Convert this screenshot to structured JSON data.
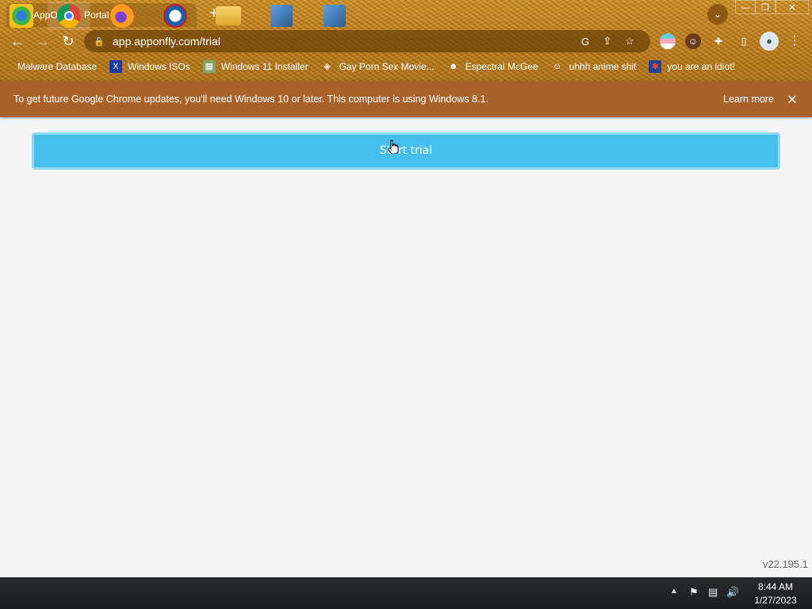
{
  "browser": {
    "tab": {
      "title": "AppOnFly - Portal",
      "favicon": "apponfly-plane-icon",
      "close": "✕"
    },
    "new_tab": "+",
    "tab_search": "⌄",
    "window_controls": {
      "minimize": "—",
      "maximize": "❐",
      "close": "✕"
    },
    "nav": {
      "back": "←",
      "forward": "→",
      "reload": "↻"
    },
    "omnibox": {
      "url": "app.apponfly.com/trial",
      "lock": "🔒",
      "google": "G",
      "share": "⇪",
      "star": "☆"
    },
    "extensions": {
      "puzzle": "✚",
      "sidepanel": "▯",
      "profile": "●",
      "menu": "⋮"
    },
    "bookmarks": [
      {
        "label": "Malware Database",
        "icon": "none"
      },
      {
        "label": "Windows ISOs",
        "icon": "X"
      },
      {
        "label": "Windows 11 Installer",
        "icon": "▦"
      },
      {
        "label": "Gay Porn Sex Movie...",
        "icon": "◈"
      },
      {
        "label": "Espectral McGee",
        "icon": "☻"
      },
      {
        "label": "uhhh anime shit",
        "icon": "☺"
      },
      {
        "label": "you are an idiot!",
        "icon": "✱"
      }
    ]
  },
  "infobar": {
    "message": "To get future Google Chrome updates, you'll need Windows 10 or later. This computer is using Windows 8.1.",
    "learn_more": "Learn more",
    "close": "✕"
  },
  "page": {
    "start_trial": "Start trial",
    "version": "v22.195.1"
  },
  "taskbar": {
    "apps": [
      "windows-media-center",
      "chrome",
      "firefox",
      "opera",
      "file-explorer",
      "installer",
      "installer"
    ],
    "time": "8:44 AM",
    "date": "1/27/2023",
    "tray": {
      "chevron": "▲",
      "flag": "⚑",
      "network": "▤",
      "volume": "🔊"
    }
  },
  "colors": {
    "accent": "#47bfee",
    "infobar": "#a8622a",
    "frame": "#b8771a"
  }
}
